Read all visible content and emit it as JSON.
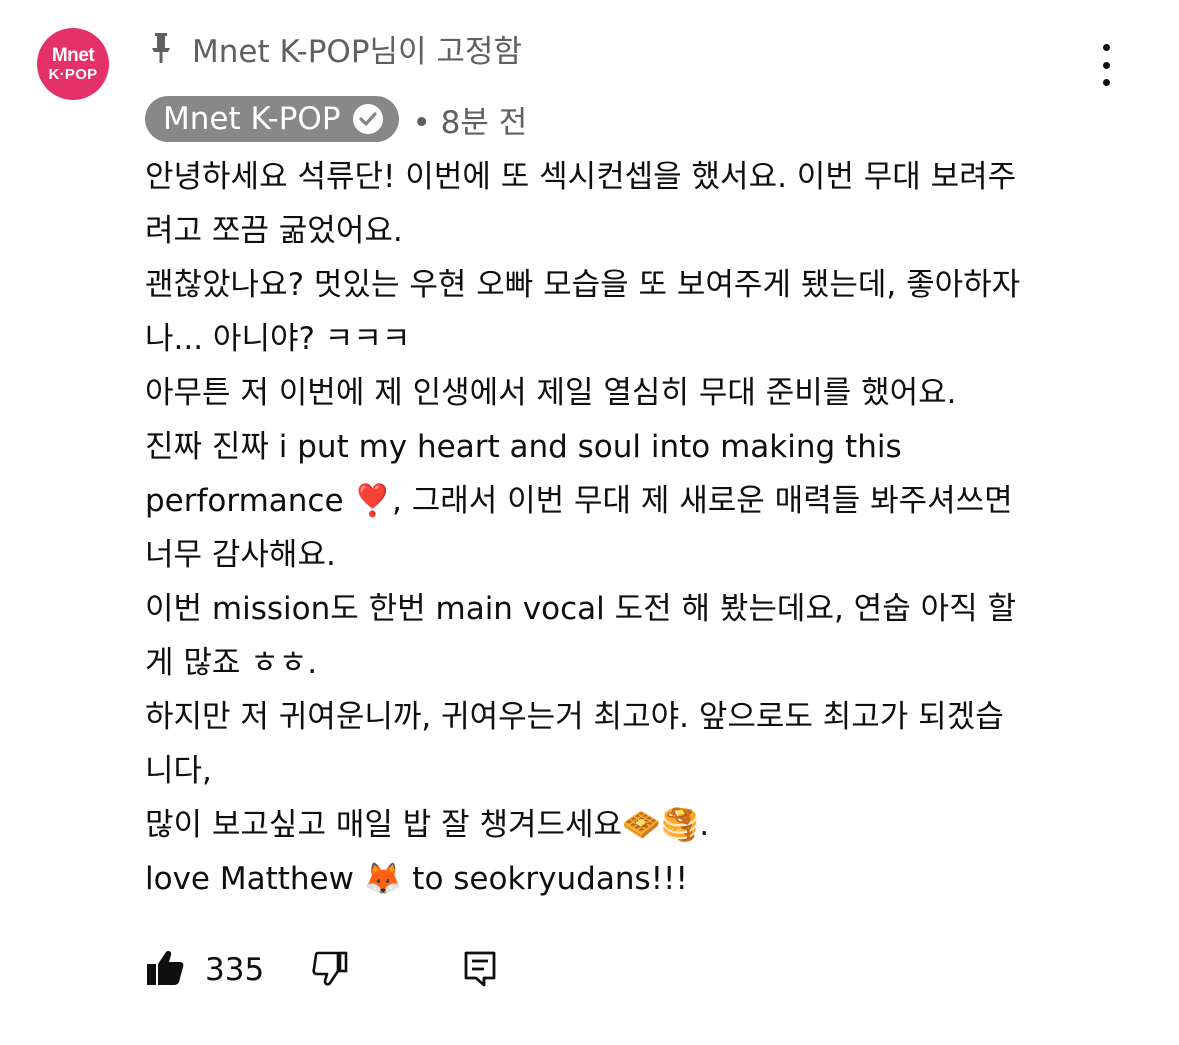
{
  "channel": {
    "avatar_line1": "Mnet",
    "avatar_line2": "K·POP",
    "avatar_color": "#e5316a"
  },
  "pinned": {
    "icon": "pin-icon",
    "text": "Mnet K-POP님이 고정함"
  },
  "comment": {
    "author": "Mnet K-POP",
    "verified_icon": "check-circle-icon",
    "time": "• 8분 전",
    "lines": [
      "안녕하세요 석류단! 이번에 또 섹시컨셉을 했서요. 이번 무대 보려주",
      "려고 쪼끔 굶었어요.",
      "괜찮았나요? 멋있는 우현 오빠 모습을 또 보여주게 됐는데, 좋아하자",
      "나... 아니야? ㅋㅋㅋ",
      "아무튼 저 이번에 제 인생에서 제일 열심히 무대 준비를 했어요.",
      "진짜 진짜 i put my heart and soul into making this",
      "performance ❣️, 그래서 이번 무대 제 새로운 매력들 봐주셔쓰면",
      "너무 감사해요.",
      "이번 mission도 한번 main vocal 도전 해 봤는데요, 연숩 아직 할",
      "게 많죠 ㅎㅎ.",
      "하지만 저 귀여운니까, 귀여우는거 최고야. 앞으로도 최고가 되겠습",
      "니다,",
      "많이 보고싶고 매일 밥 잘 챙겨드세요🧇🥞.",
      "love Matthew 🦊 to seokryudans!!!"
    ]
  },
  "actions": {
    "like_icon": "thumbs-up-icon",
    "like_count": "335",
    "dislike_icon": "thumbs-down-icon",
    "reply_icon": "reply-icon"
  },
  "menu": {
    "icon": "more-vertical-icon"
  }
}
